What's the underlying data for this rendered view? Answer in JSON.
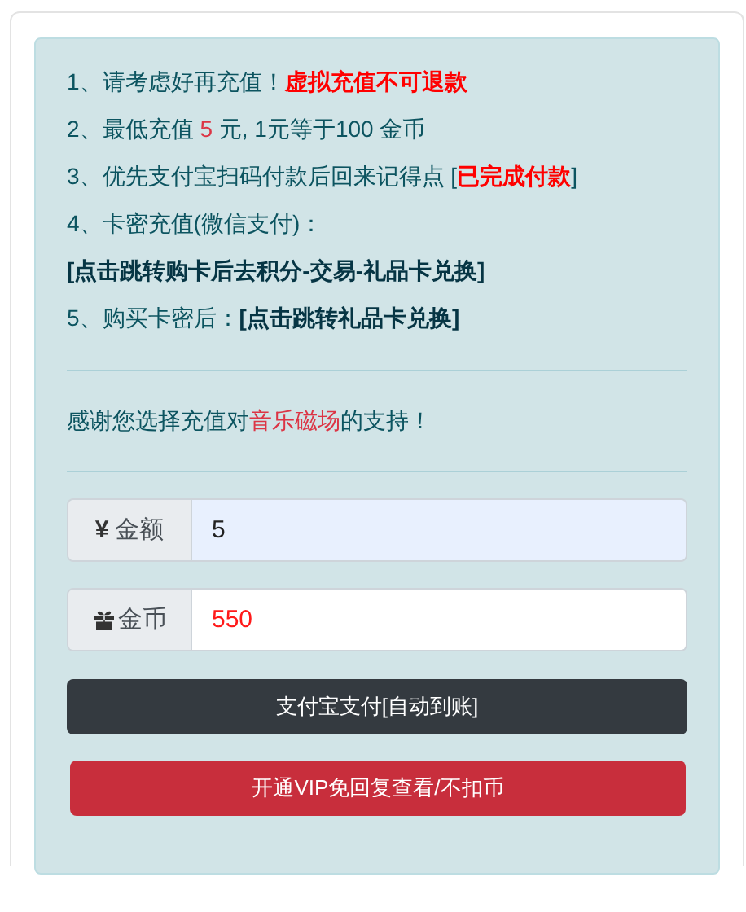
{
  "notes": [
    [
      {
        "kind": "plain",
        "text": "1、请考虑好再充值！"
      },
      {
        "kind": "alert",
        "text": "虚拟充值不可退款"
      }
    ],
    [
      {
        "kind": "plain",
        "text": "2、最低充值 "
      },
      {
        "kind": "number",
        "text": "5"
      },
      {
        "kind": "plain",
        "text": " 元, 1元等于100 金币"
      }
    ],
    [
      {
        "kind": "plain",
        "text": "3、优先支付宝扫码付款后回来记得点 ["
      },
      {
        "kind": "alert",
        "text": "已完成付款"
      },
      {
        "kind": "plain",
        "text": "]"
      }
    ],
    [
      {
        "kind": "plain",
        "text": "4、卡密充值(微信支付)："
      },
      {
        "kind": "link",
        "text": "[点击跳转购卡后去积分-交易-礼品卡兑换]"
      }
    ],
    [
      {
        "kind": "plain",
        "text": "5、购买卡密后："
      },
      {
        "kind": "link",
        "text": "[点击跳转礼品卡兑换]"
      }
    ]
  ],
  "thanks": [
    {
      "kind": "plain",
      "text": "感谢您选择充值对"
    },
    {
      "kind": "number",
      "text": "音乐磁场"
    },
    {
      "kind": "plain",
      "text": "的支持！"
    }
  ],
  "fields": [
    {
      "kind": "symbol",
      "prefix": "¥",
      "label": "金额",
      "value": "5",
      "autofilled": true,
      "red_value": false
    },
    {
      "kind": "gift",
      "label": "金币",
      "value": "550",
      "autofilled": false,
      "red_value": true
    }
  ],
  "buttons": [
    {
      "kind": "dark",
      "label": "支付宝支付[自动到账]"
    },
    {
      "kind": "danger",
      "label": "开通VIP免回复查看/不扣币"
    }
  ]
}
